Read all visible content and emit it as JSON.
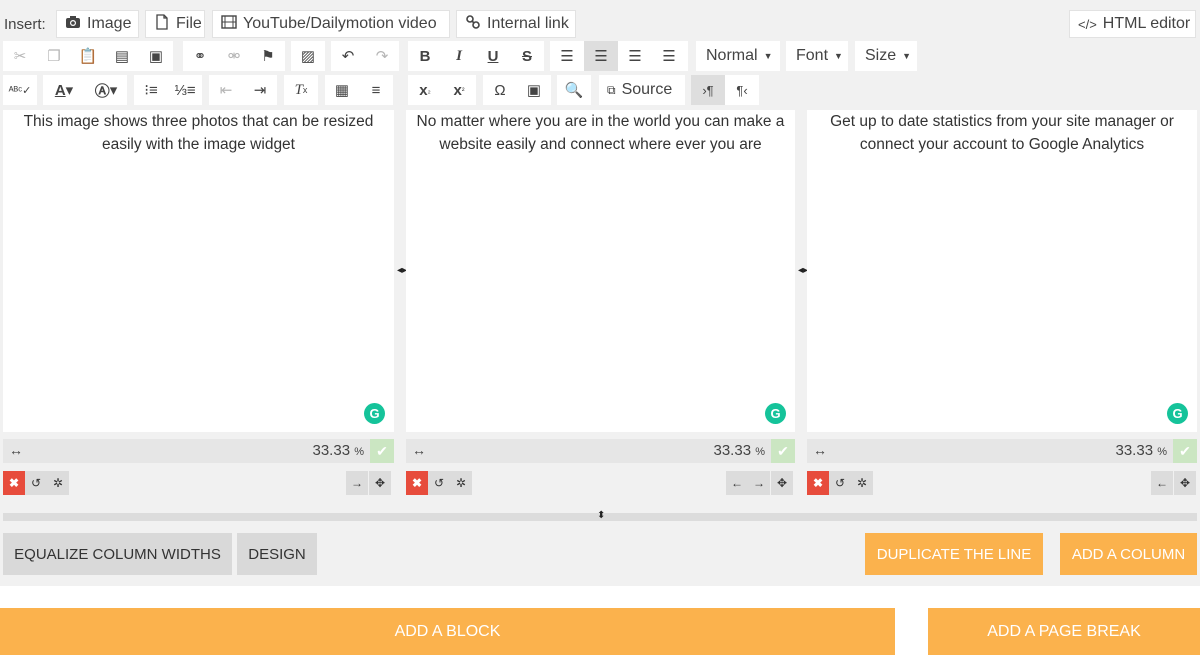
{
  "insert": {
    "label": "Insert:",
    "image": "Image",
    "file": "File",
    "video": "YouTube/Dailymotion video",
    "internal_link": "Internal link",
    "html_editor": "HTML editor"
  },
  "toolbar": {
    "format": "Normal",
    "font": "Font",
    "size": "Size",
    "source": "Source"
  },
  "columns": [
    {
      "text": "This image shows three photos that can be resized easily with the image widget",
      "width": "33.33",
      "unit": "%"
    },
    {
      "text": "No matter where you are in the world you can make a website easily and connect where ever you are",
      "width": "33.33",
      "unit": "%"
    },
    {
      "text": "Get up to date statistics from your site manager or connect your account to Google Analytics",
      "width": "33.33",
      "unit": "%"
    }
  ],
  "actions": {
    "equalize": "EQUALIZE COLUMN WIDTHS",
    "design": "DESIGN",
    "duplicate": "DUPLICATE THE LINE",
    "add_column": "ADD A COLUMN",
    "add_block": "ADD A BLOCK",
    "add_page_break": "ADD A PAGE BREAK"
  },
  "colors": {
    "accent": "#fbb24d",
    "delete": "#e74c3c",
    "grammarly": "#15c39a"
  }
}
